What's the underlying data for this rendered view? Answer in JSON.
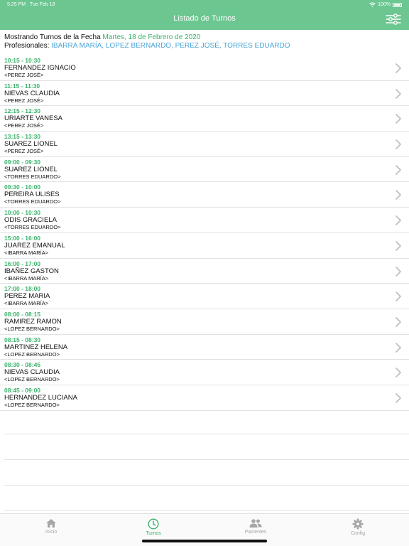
{
  "status": {
    "time": "5:25 PM",
    "date": "Tue Feb 18",
    "battery": "100%"
  },
  "header": {
    "title": "Listado de Turnos"
  },
  "info": {
    "prefix": "Mostrando Turnos de la Fecha",
    "date": "Martes, 18 de Febrero de 2020",
    "prof_label": "Profesionales:",
    "professionals": "IBARRA MARÍA, LOPEZ BERNARDO, PEREZ JOSÉ, TORRES EDUARDO"
  },
  "appointments": [
    {
      "time": "10:15 - 10:30",
      "patient": "FERNANDEZ IGNACIO",
      "prof": "<PEREZ JOSÉ>"
    },
    {
      "time": "11:15 - 11:30",
      "patient": "NIEVAS CLAUDIA",
      "prof": "<PEREZ JOSÉ>"
    },
    {
      "time": "12:15 - 12:30",
      "patient": "URIARTE VANESA",
      "prof": "<PEREZ JOSÉ>"
    },
    {
      "time": "13:15 - 13:30",
      "patient": "SUAREZ LIONEL",
      "prof": "<PEREZ JOSÉ>"
    },
    {
      "time": "09:00 - 09:30",
      "patient": "SUAREZ LIONEL",
      "prof": "<TORRES EDUARDO>"
    },
    {
      "time": "09:30 - 10:00",
      "patient": "PEREIRA ULISES",
      "prof": "<TORRES EDUARDO>"
    },
    {
      "time": "10:00 - 10:30",
      "patient": "ODIS GRACIELA",
      "prof": "<TORRES EDUARDO>"
    },
    {
      "time": "15:00 - 16:00",
      "patient": "JUAREZ EMANUAL",
      "prof": "<IBARRA MARÍA>"
    },
    {
      "time": "16:00 - 17:00",
      "patient": "IBAÑEZ GASTON",
      "prof": "<IBARRA MARÍA>"
    },
    {
      "time": "17:00 - 18:00",
      "patient": "PEREZ MARIA",
      "prof": "<IBARRA MARÍA>"
    },
    {
      "time": "08:00 - 08:15",
      "patient": "RAMIREZ RAMON",
      "prof": "<LOPEZ BERNARDO>"
    },
    {
      "time": "08:15 - 08:30",
      "patient": "MARTINEZ HELENA",
      "prof": "<LOPEZ BERNARDO>"
    },
    {
      "time": "08:30 - 08:45",
      "patient": "NIEVAS CLAUDIA",
      "prof": "<LOPEZ BERNARDO>"
    },
    {
      "time": "08:45 - 09:00",
      "patient": "HERNANDEZ LUCIANA",
      "prof": "<LOPEZ BERNARDO>"
    }
  ],
  "tabs": {
    "inicio": "Inicio",
    "turnos": "Turnos",
    "pacientes": "Pacientes",
    "config": "Config"
  },
  "colors": {
    "header": "#6cc690",
    "accent": "#3ab36b",
    "link": "#4aa6d8",
    "inactive": "#a6a6a6"
  },
  "icons": {
    "filter": "sliders-icon",
    "row": "chevron-right-icon",
    "inicio": "home-icon",
    "turnos": "clock-icon",
    "pacientes": "people-icon",
    "config": "gear-icon"
  }
}
